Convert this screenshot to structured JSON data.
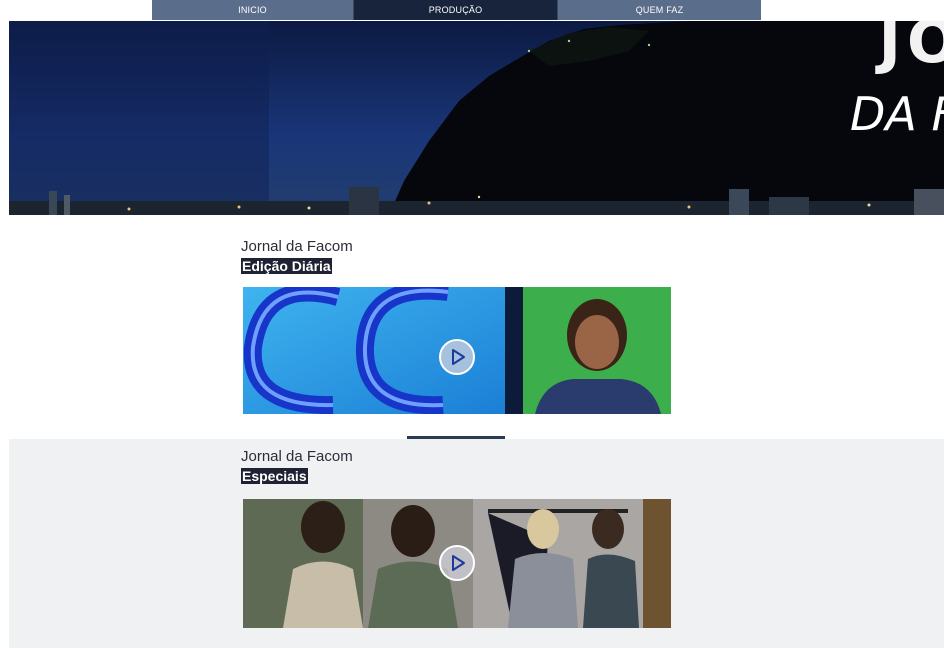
{
  "nav": {
    "items": [
      {
        "label": "INICIO"
      },
      {
        "label": "PRODUÇÃO"
      },
      {
        "label": "QUEM FAZ"
      }
    ]
  },
  "hero": {
    "line1": "JO",
    "line2": "DA F"
  },
  "sections": [
    {
      "title": "Jornal da Facom",
      "subtitle": "Edição Diária",
      "play_icon": "play-icon"
    },
    {
      "title": "Jornal da Facom",
      "subtitle": "Especiais",
      "play_icon": "play-icon"
    }
  ],
  "colors": {
    "nav_light": "#5a6d8a",
    "nav_dark": "#17243b",
    "subtitle_bg": "#1f2233",
    "band_bg": "#f0f1f3"
  }
}
